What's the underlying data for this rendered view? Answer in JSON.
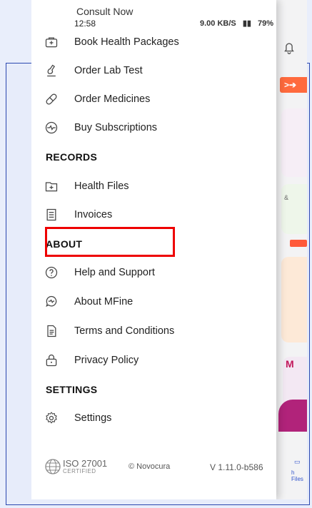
{
  "status_bar": {
    "time": "12:58",
    "indicators": "9.00 KB/S",
    "battery": "79%"
  },
  "menu": {
    "partial_item": "Consult Now",
    "primary_items": [
      {
        "label": "Book Health Packages",
        "icon": "health-package-icon"
      },
      {
        "label": "Order Lab Test",
        "icon": "lab-test-icon"
      },
      {
        "label": "Order Medicines",
        "icon": "pill-icon"
      },
      {
        "label": "Buy Subscriptions",
        "icon": "subscription-icon"
      }
    ],
    "records_header": "RECORDS",
    "records_items": [
      {
        "label": "Health Files",
        "icon": "health-file-icon"
      },
      {
        "label": "Invoices",
        "icon": "invoice-icon"
      }
    ],
    "about_header": "ABOUT",
    "about_items": [
      {
        "label": "Help and Support",
        "icon": "help-icon"
      },
      {
        "label": "About MFine",
        "icon": "about-icon"
      },
      {
        "label": "Terms and Conditions",
        "icon": "document-icon"
      },
      {
        "label": "Privacy Policy",
        "icon": "lock-icon"
      }
    ],
    "settings_header": "SETTINGS",
    "settings_items": [
      {
        "label": "Settings",
        "icon": "gear-icon"
      }
    ]
  },
  "footer": {
    "iso": "ISO 27001",
    "iso_sub": "CERTIFIED",
    "copyright": "© Novocura",
    "version": "V 1.11.0-b586"
  },
  "background_app": {
    "bottom_label": "h Files"
  },
  "colors": {
    "accent_orange": "#ff6a3d",
    "highlight_red": "#ee0000",
    "frame_blue": "#2b47b0"
  }
}
